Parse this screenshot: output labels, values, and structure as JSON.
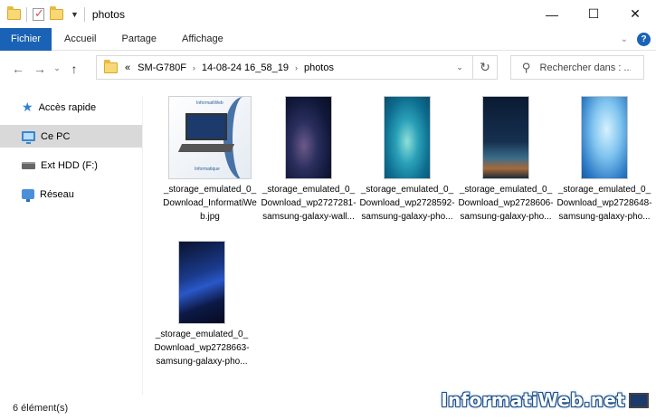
{
  "window": {
    "title": "photos"
  },
  "window_buttons": {
    "minimize": "—",
    "maximize": "☐",
    "close": "✕"
  },
  "ribbon": {
    "tabs": [
      "Fichier",
      "Accueil",
      "Partage",
      "Affichage"
    ],
    "active_tab": "Fichier",
    "collapse_glyph": "⌄",
    "help_glyph": "?"
  },
  "nav": {
    "back": "←",
    "forward": "→",
    "recent": "⌄",
    "up": "↑",
    "refresh": "↻",
    "dropdown": "⌄"
  },
  "address": {
    "overflow": "«",
    "crumbs": [
      "SM-G780F",
      "14-08-24 16_58_19",
      "photos"
    ],
    "separator": "›"
  },
  "search": {
    "placeholder": "Rechercher dans : ..."
  },
  "sidebar": {
    "items": [
      {
        "label": "Accès rapide",
        "icon": "star-icon"
      },
      {
        "label": "Ce PC",
        "icon": "computer-icon",
        "selected": true
      },
      {
        "label": "Ext HDD (F:)",
        "icon": "hard-drive-icon"
      },
      {
        "label": "Réseau",
        "icon": "network-icon"
      }
    ]
  },
  "files": [
    {
      "name": "_storage_emulated_0_Download_InformatiWeb.jpg",
      "thumb": "informatiweb-image-thumbnail",
      "thumb_caption": "Informatique",
      "thumb_header": "InformatiWeb"
    },
    {
      "name": "_storage_emulated_0_Download_wp2727281-samsung-galaxy-wall...",
      "thumb": "galaxy-wallpaper-thumbnail"
    },
    {
      "name": "_storage_emulated_0_Download_wp2728592-samsung-galaxy-pho...",
      "thumb": "teal-wallpaper-thumbnail"
    },
    {
      "name": "_storage_emulated_0_Download_wp2728606-samsung-galaxy-pho...",
      "thumb": "night-sky-wallpaper-thumbnail"
    },
    {
      "name": "_storage_emulated_0_Download_wp2728648-samsung-galaxy-pho...",
      "thumb": "water-splash-wallpaper-thumbnail"
    },
    {
      "name": "_storage_emulated_0_Download_wp2728663-samsung-galaxy-pho...",
      "thumb": "blue-abstract-wallpaper-thumbnail"
    }
  ],
  "status": {
    "count": "6 élément(s)"
  },
  "watermark": {
    "text": "InformatiWeb.net"
  },
  "colors": {
    "accent": "#1a62b5",
    "selected": "#d9d9d9",
    "folder": "#f8d775"
  }
}
